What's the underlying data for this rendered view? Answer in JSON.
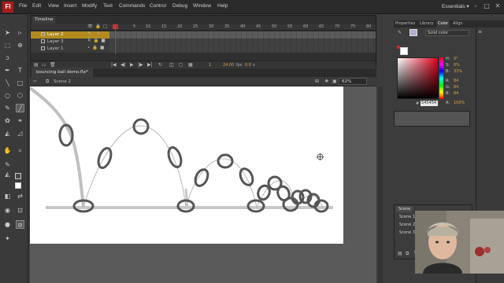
{
  "app": {
    "logo": "Fl"
  },
  "menu": [
    "File",
    "Edit",
    "View",
    "Insert",
    "Modify",
    "Text",
    "Commands",
    "Control",
    "Debug",
    "Window",
    "Help"
  ],
  "workspace": "Essentials ▾",
  "timeline": {
    "tab": "Timeline",
    "frame_numbers": [
      "1",
      "5",
      "10",
      "15",
      "20",
      "25",
      "30",
      "35",
      "40",
      "45",
      "50",
      "55",
      "60",
      "65",
      "70",
      "75",
      "80"
    ],
    "layers": [
      {
        "name": "Layer 2",
        "selected": true
      },
      {
        "name": "Layer 3",
        "selected": false
      },
      {
        "name": "Layer 1",
        "selected": false
      }
    ],
    "current_frame": "1",
    "fps": "24.00",
    "fps_unit": "fps",
    "time": "0.0",
    "time_unit": "s"
  },
  "document": {
    "tab": "bouncing ball demo.fla*",
    "scene": "Scene 2",
    "zoom": "62%"
  },
  "panels": {
    "tabs": [
      "Properties",
      "Library",
      "Color",
      "Align"
    ],
    "active_tab": "Color",
    "fill_type": "Solid color",
    "hsb": [
      {
        "label": "H:",
        "value": "0°"
      },
      {
        "label": "S:",
        "value": "0%"
      },
      {
        "label": "B:",
        "value": "33%"
      },
      {
        "label": "R:",
        "value": "84"
      },
      {
        "label": "G:",
        "value": "84"
      },
      {
        "label": "B:",
        "value": "84"
      },
      {
        "label": "A:",
        "value": "100%"
      }
    ],
    "hex_label": "#",
    "hex": "545454",
    "current_color": "#545454"
  },
  "scene_panel": {
    "tab": "Scene",
    "items": [
      "Scene 1",
      "Scene 2",
      "Scene 3"
    ]
  }
}
